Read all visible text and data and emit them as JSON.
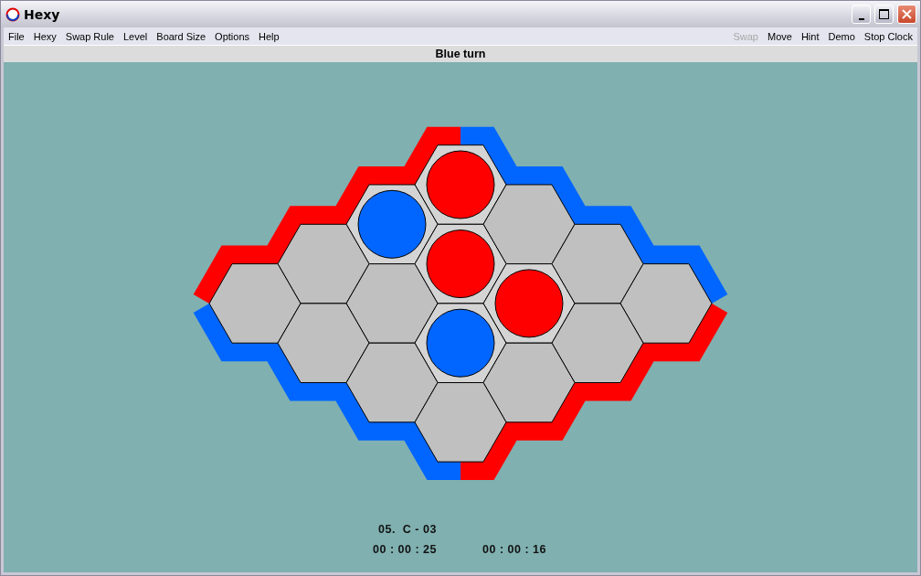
{
  "window": {
    "title": "Hexy"
  },
  "menu": [
    {
      "label": "File"
    },
    {
      "label": "Hexy"
    },
    {
      "label": "Swap Rule"
    },
    {
      "label": "Level"
    },
    {
      "label": "Board Size"
    },
    {
      "label": "Options"
    },
    {
      "label": "Help"
    }
  ],
  "actions": [
    {
      "label": "Swap",
      "disabled": true
    },
    {
      "label": "Move",
      "disabled": false
    },
    {
      "label": "Hint",
      "disabled": false
    },
    {
      "label": "Demo",
      "disabled": false
    },
    {
      "label": "Stop Clock",
      "disabled": false
    }
  ],
  "status": "Blue turn",
  "board": {
    "rows": [
      [
        {
          "occupied": true,
          "color": "#ff0000"
        },
        {
          "occupied": false
        },
        {
          "occupied": false
        },
        {
          "occupied": false
        }
      ],
      [
        {
          "occupied": true,
          "color": "#0066ff"
        },
        {
          "occupied": true,
          "color": "#ff0000"
        },
        {
          "occupied": true,
          "color": "#ff0000"
        },
        {
          "occupied": false
        }
      ],
      [
        {
          "occupied": false
        },
        {
          "occupied": false
        },
        {
          "occupied": true,
          "color": "#0066ff"
        },
        {
          "occupied": false
        }
      ],
      [
        {
          "occupied": false
        },
        {
          "occupied": false
        },
        {
          "occupied": false
        },
        {
          "occupied": false
        }
      ]
    ]
  },
  "last_move": "05.  C - 03",
  "clocks": [
    "00 : 00 : 25",
    "00 : 00 : 16"
  ]
}
